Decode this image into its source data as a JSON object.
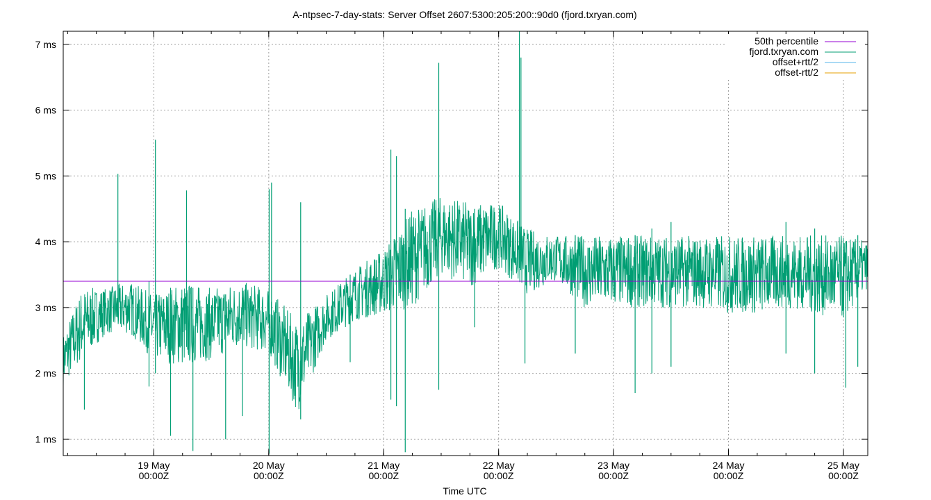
{
  "chart_data": {
    "type": "line",
    "title": "A-ntpsec-7-day-stats: Server Offset 2607:5300:205:200::90d0 (fjord.txryan.com)",
    "xlabel": "Time UTC",
    "ylabel": "",
    "y_unit": "ms",
    "ylim": [
      0.75,
      7.2
    ],
    "xlim": [
      "2025-05-18T05:05Z",
      "2025-05-25T05:05Z"
    ],
    "grid": true,
    "legend_position": "top-right",
    "x_ticks": [
      {
        "date": "2025-05-19T00:00Z",
        "line1": "19 May",
        "line2": "00:00Z"
      },
      {
        "date": "2025-05-20T00:00Z",
        "line1": "20 May",
        "line2": "00:00Z"
      },
      {
        "date": "2025-05-21T00:00Z",
        "line1": "21 May",
        "line2": "00:00Z"
      },
      {
        "date": "2025-05-22T00:00Z",
        "line1": "22 May",
        "line2": "00:00Z"
      },
      {
        "date": "2025-05-23T00:00Z",
        "line1": "23 May",
        "line2": "00:00Z"
      },
      {
        "date": "2025-05-24T00:00Z",
        "line1": "24 May",
        "line2": "00:00Z"
      },
      {
        "date": "2025-05-25T00:00Z",
        "line1": "25 May",
        "line2": "00:00Z"
      }
    ],
    "y_ticks": [
      {
        "value": 1,
        "label": "1 ms"
      },
      {
        "value": 2,
        "label": "2 ms"
      },
      {
        "value": 3,
        "label": "3 ms"
      },
      {
        "value": 4,
        "label": "4 ms"
      },
      {
        "value": 5,
        "label": "5 ms"
      },
      {
        "value": 6,
        "label": "6 ms"
      },
      {
        "value": 7,
        "label": "7 ms"
      }
    ],
    "series": [
      {
        "name": "50th percentile",
        "color": "#9400d3",
        "kind": "hline",
        "value": 3.4
      },
      {
        "name": "fjord.txryan.com",
        "color": "#009e73",
        "kind": "envelope",
        "points": [
          {
            "t": "2025-05-18T05:05Z",
            "lo": 1.8,
            "hi": 2.6
          },
          {
            "t": "2025-05-18T09:00Z",
            "lo": 2.2,
            "hi": 3.3
          },
          {
            "t": "2025-05-18T14:00Z",
            "lo": 2.6,
            "hi": 3.3
          },
          {
            "t": "2025-05-18T19:00Z",
            "lo": 2.6,
            "hi": 3.4
          },
          {
            "t": "2025-05-19T00:00Z",
            "lo": 2.2,
            "hi": 3.2
          },
          {
            "t": "2025-05-19T06:00Z",
            "lo": 2.1,
            "hi": 3.4
          },
          {
            "t": "2025-05-19T12:00Z",
            "lo": 2.2,
            "hi": 3.3
          },
          {
            "t": "2025-05-19T18:00Z",
            "lo": 2.4,
            "hi": 3.4
          },
          {
            "t": "2025-05-20T00:00Z",
            "lo": 2.3,
            "hi": 3.3
          },
          {
            "t": "2025-05-20T06:00Z",
            "lo": 1.4,
            "hi": 2.8
          },
          {
            "t": "2025-05-20T12:00Z",
            "lo": 2.5,
            "hi": 3.2
          },
          {
            "t": "2025-05-20T18:00Z",
            "lo": 2.8,
            "hi": 3.6
          },
          {
            "t": "2025-05-21T00:00Z",
            "lo": 2.9,
            "hi": 3.9
          },
          {
            "t": "2025-05-21T06:00Z",
            "lo": 3.0,
            "hi": 4.5
          },
          {
            "t": "2025-05-21T12:00Z",
            "lo": 3.5,
            "hi": 4.7
          },
          {
            "t": "2025-05-21T18:00Z",
            "lo": 3.3,
            "hi": 4.6
          },
          {
            "t": "2025-05-22T00:00Z",
            "lo": 3.6,
            "hi": 4.6
          },
          {
            "t": "2025-05-22T06:00Z",
            "lo": 3.2,
            "hi": 4.2
          },
          {
            "t": "2025-05-22T12:00Z",
            "lo": 3.4,
            "hi": 4.1
          },
          {
            "t": "2025-05-22T18:00Z",
            "lo": 3.0,
            "hi": 4.1
          },
          {
            "t": "2025-05-23T00:00Z",
            "lo": 3.0,
            "hi": 4.1
          },
          {
            "t": "2025-05-23T06:00Z",
            "lo": 3.0,
            "hi": 4.1
          },
          {
            "t": "2025-05-23T12:00Z",
            "lo": 3.0,
            "hi": 4.1
          },
          {
            "t": "2025-05-23T18:00Z",
            "lo": 3.0,
            "hi": 4.1
          },
          {
            "t": "2025-05-24T00:00Z",
            "lo": 2.9,
            "hi": 4.1
          },
          {
            "t": "2025-05-24T06:00Z",
            "lo": 2.9,
            "hi": 4.1
          },
          {
            "t": "2025-05-24T12:00Z",
            "lo": 3.0,
            "hi": 4.1
          },
          {
            "t": "2025-05-24T18:00Z",
            "lo": 2.9,
            "hi": 4.1
          },
          {
            "t": "2025-05-25T00:00Z",
            "lo": 2.8,
            "hi": 4.1
          },
          {
            "t": "2025-05-25T05:05Z",
            "lo": 3.3,
            "hi": 4.0
          }
        ],
        "spikes": [
          {
            "t": "2025-05-18T09:30Z",
            "lo": 1.45,
            "hi": 2.9
          },
          {
            "t": "2025-05-18T16:30Z",
            "lo": 2.9,
            "hi": 5.03
          },
          {
            "t": "2025-05-18T23:00Z",
            "lo": 1.8,
            "hi": 3.4
          },
          {
            "t": "2025-05-19T00:20Z",
            "lo": 2.0,
            "hi": 5.55
          },
          {
            "t": "2025-05-19T03:30Z",
            "lo": 1.05,
            "hi": 3.3
          },
          {
            "t": "2025-05-19T06:50Z",
            "lo": 2.4,
            "hi": 4.78
          },
          {
            "t": "2025-05-19T08:10Z",
            "lo": 0.82,
            "hi": 3.3
          },
          {
            "t": "2025-05-19T15:00Z",
            "lo": 1.0,
            "hi": 3.2
          },
          {
            "t": "2025-05-19T18:30Z",
            "lo": 1.35,
            "hi": 3.3
          },
          {
            "t": "2025-05-20T00:05Z",
            "lo": 0.78,
            "hi": 4.8
          },
          {
            "t": "2025-05-20T00:35Z",
            "lo": 2.3,
            "hi": 4.9
          },
          {
            "t": "2025-05-20T06:40Z",
            "lo": 1.3,
            "hi": 4.6
          },
          {
            "t": "2025-05-20T17:00Z",
            "lo": 2.17,
            "hi": 3.5
          },
          {
            "t": "2025-05-21T01:30Z",
            "lo": 1.6,
            "hi": 5.4
          },
          {
            "t": "2025-05-21T02:40Z",
            "lo": 1.5,
            "hi": 5.3
          },
          {
            "t": "2025-05-21T04:30Z",
            "lo": 0.8,
            "hi": 4.5
          },
          {
            "t": "2025-05-21T11:30Z",
            "lo": 1.75,
            "hi": 6.72
          },
          {
            "t": "2025-05-21T19:00Z",
            "lo": 2.7,
            "hi": 4.5
          },
          {
            "t": "2025-05-22T04:20Z",
            "lo": 3.6,
            "hi": 7.2
          },
          {
            "t": "2025-05-22T04:40Z",
            "lo": 3.7,
            "hi": 6.8
          },
          {
            "t": "2025-05-22T05:30Z",
            "lo": 2.15,
            "hi": 4.0
          },
          {
            "t": "2025-05-22T16:00Z",
            "lo": 2.3,
            "hi": 4.1
          },
          {
            "t": "2025-05-23T04:30Z",
            "lo": 1.7,
            "hi": 4.1
          },
          {
            "t": "2025-05-23T08:00Z",
            "lo": 2.0,
            "hi": 4.2
          },
          {
            "t": "2025-05-23T12:00Z",
            "lo": 2.1,
            "hi": 4.3
          },
          {
            "t": "2025-05-24T12:00Z",
            "lo": 2.3,
            "hi": 4.3
          },
          {
            "t": "2025-05-24T18:00Z",
            "lo": 2.0,
            "hi": 4.2
          },
          {
            "t": "2025-05-25T00:30Z",
            "lo": 1.78,
            "hi": 4.0
          },
          {
            "t": "2025-05-25T03:00Z",
            "lo": 2.1,
            "hi": 4.1
          }
        ]
      },
      {
        "name": "offset+rtt/2",
        "color": "#56b4e9",
        "kind": "legend-only"
      },
      {
        "name": "offset-rtt/2",
        "color": "#e69f00",
        "kind": "legend-only"
      }
    ]
  }
}
